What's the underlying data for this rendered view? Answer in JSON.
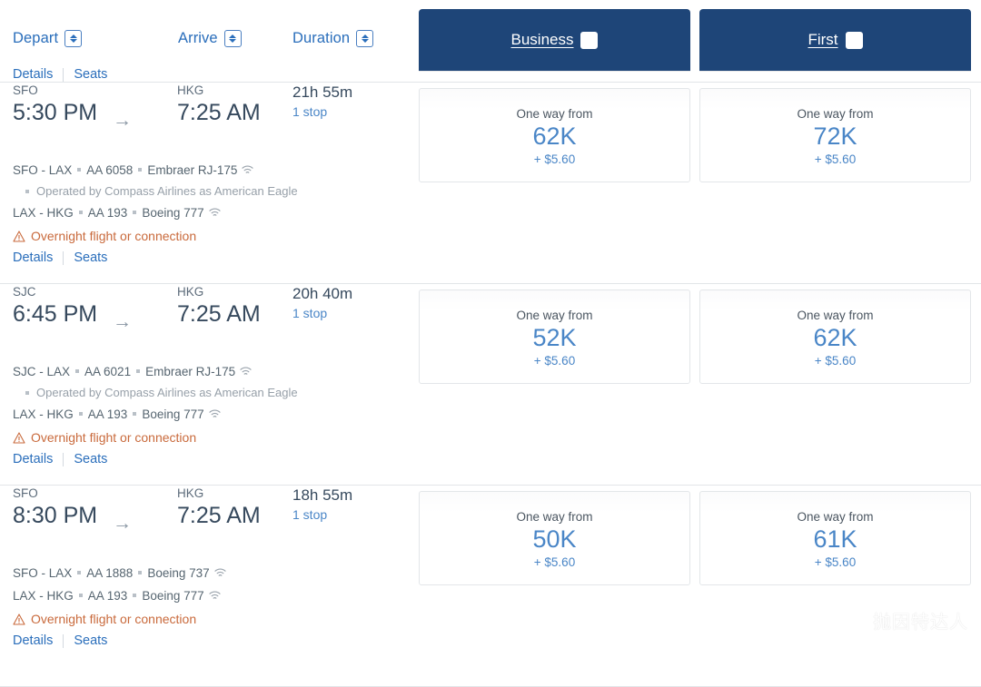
{
  "sort_bar": {
    "controls": [
      {
        "label": "Depart",
        "icon": "sort-stepper-icon"
      },
      {
        "label": "Arrive",
        "icon": "sort-stepper-icon"
      },
      {
        "label": "Duration",
        "icon": "sort-stepper-icon"
      }
    ]
  },
  "cabin_tabs": [
    {
      "label": "Business",
      "icon": "sort-stepper-icon",
      "active": true
    },
    {
      "label": "First",
      "icon": "sort-stepper-icon",
      "active": true
    }
  ],
  "colors": {
    "tab_navy": "#1e4578",
    "link_blue": "#2a6ebb",
    "price_blue": "#4a86c7",
    "warning_orange": "#c96a3c",
    "text_dark": "#36495d",
    "divider_gray": "#e2e5e8"
  },
  "common": {
    "details_label": "Details",
    "seats_label": "Seats",
    "one_way_from": "One way from",
    "overnight_warning": "Overnight flight or connection",
    "arrow_glyph": "→"
  },
  "partial_row_top": {
    "details_label": "Details",
    "seats_label": "Seats"
  },
  "flights": [
    {
      "origin": "SFO",
      "depart_time": "5:30 PM",
      "destination": "HKG",
      "arrive_time": "7:25 AM",
      "duration": "21h 55m",
      "stops": "1 stop",
      "legs": [
        {
          "route": "SFO - LAX",
          "flight_number": "AA 6058",
          "aircraft": "Embraer RJ-175",
          "wifi": true,
          "operated_by": "Operated by Compass Airlines as American Eagle"
        },
        {
          "route": "LAX - HKG",
          "flight_number": "AA 193",
          "aircraft": "Boeing 777",
          "wifi": true,
          "operated_by": null
        }
      ],
      "overnight": true,
      "prices": {
        "business": {
          "miles": "62K",
          "tax": "+ $5.60"
        },
        "first": {
          "miles": "72K",
          "tax": "+ $5.60"
        }
      }
    },
    {
      "origin": "SJC",
      "depart_time": "6:45 PM",
      "destination": "HKG",
      "arrive_time": "7:25 AM",
      "duration": "20h 40m",
      "stops": "1 stop",
      "legs": [
        {
          "route": "SJC - LAX",
          "flight_number": "AA 6021",
          "aircraft": "Embraer RJ-175",
          "wifi": true,
          "operated_by": "Operated by Compass Airlines as American Eagle"
        },
        {
          "route": "LAX - HKG",
          "flight_number": "AA 193",
          "aircraft": "Boeing 777",
          "wifi": true,
          "operated_by": null
        }
      ],
      "overnight": true,
      "prices": {
        "business": {
          "miles": "52K",
          "tax": "+ $5.60"
        },
        "first": {
          "miles": "62K",
          "tax": "+ $5.60"
        }
      }
    },
    {
      "origin": "SFO",
      "depart_time": "8:30 PM",
      "destination": "HKG",
      "arrive_time": "7:25 AM",
      "duration": "18h 55m",
      "stops": "1 stop",
      "legs": [
        {
          "route": "SFO - LAX",
          "flight_number": "AA 1888",
          "aircraft": "Boeing 737",
          "wifi": true,
          "operated_by": null
        },
        {
          "route": "LAX - HKG",
          "flight_number": "AA 193",
          "aircraft": "Boeing 777",
          "wifi": true,
          "operated_by": null
        }
      ],
      "overnight": true,
      "prices": {
        "business": {
          "miles": "50K",
          "tax": "+ $5.60"
        },
        "first": {
          "miles": "61K",
          "tax": "+ $5.60"
        }
      }
    }
  ],
  "watermark": {
    "text": "抛因特达人",
    "icon": "wechat-icon"
  }
}
